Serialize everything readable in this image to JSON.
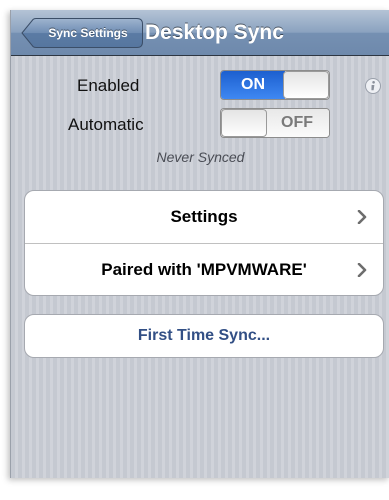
{
  "navbar": {
    "back_label": "Sync Settings",
    "title": "Desktop Sync"
  },
  "toggles": [
    {
      "label": "Enabled",
      "state": "ON",
      "on": true
    },
    {
      "label": "Automatic",
      "state": "OFF",
      "on": false
    }
  ],
  "status": "Never Synced",
  "menu": [
    {
      "label": "Settings"
    },
    {
      "label": "Paired with 'MPVMWARE'"
    }
  ],
  "action": {
    "label": "First Time Sync..."
  },
  "colors": {
    "toggle_on": "#2f74e3",
    "button_text": "#324f85",
    "background": "#c8cbd3"
  },
  "icons": {
    "info": "info-icon",
    "disclosure": "chevron-right-icon"
  }
}
